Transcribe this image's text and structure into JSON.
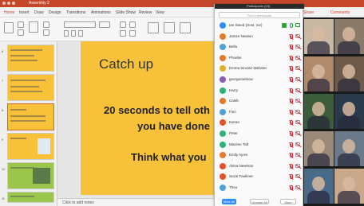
{
  "app": {
    "title": "Assembly 2",
    "brand_color": "#c4472a"
  },
  "ribbon": {
    "tabs": [
      "Home",
      "Insert",
      "Draw",
      "Design",
      "Transitions",
      "Animations",
      "Slide Show",
      "Review",
      "View"
    ],
    "share_label": "Share",
    "comments_label": "Comments"
  },
  "thumbnails": [
    {
      "number": "6"
    },
    {
      "number": "7"
    },
    {
      "number": "8"
    },
    {
      "number": "9"
    },
    {
      "number": "10"
    },
    {
      "number": "11"
    },
    {
      "number": "12"
    }
  ],
  "slide": {
    "title": "Catch up",
    "line1": "20 seconds to tell oth",
    "line2": "you have done",
    "line3": "Think what you",
    "background": "#f7c23a"
  },
  "notes": {
    "placeholder": "Click to add notes"
  },
  "participants_panel": {
    "header": "Participants (23)",
    "search_placeholder": "Find a participant",
    "participants": [
      {
        "name": "Ian Steed (Host, me)",
        "avatar_color": "#2d8cff",
        "mic": "on",
        "cam": "on"
      },
      {
        "name": "James Newton",
        "avatar_color": "#e57a2b",
        "mic": "off",
        "cam": "off"
      },
      {
        "name": "Bella",
        "avatar_color": "#4fa3d9",
        "mic": "off",
        "cam": "off"
      },
      {
        "name": "Phoebe",
        "avatar_color": "#e57a2b",
        "mic": "off",
        "cam": "off"
      },
      {
        "name": "Emma Sinclair-Webster",
        "avatar_color": "#e5b02b",
        "mic": "off",
        "cam": "off"
      },
      {
        "name": "georgerainbow",
        "avatar_color": "#8d5ab7",
        "mic": "off",
        "cam": "off"
      },
      {
        "name": "Harry",
        "avatar_color": "#2fb17a",
        "mic": "off",
        "cam": "off"
      },
      {
        "name": "Caleb",
        "avatar_color": "#e57a2b",
        "mic": "off",
        "cam": "off"
      },
      {
        "name": "Finn",
        "avatar_color": "#4fa3d9",
        "mic": "off",
        "cam": "off"
      },
      {
        "name": "Kieran",
        "avatar_color": "#e5502b",
        "mic": "off",
        "cam": "off"
      },
      {
        "name": "Peter",
        "avatar_color": "#2fb17a",
        "mic": "off",
        "cam": "off"
      },
      {
        "name": "Maxime Taft",
        "avatar_color": "#2fb17a",
        "mic": "off",
        "cam": "off"
      },
      {
        "name": "Emily Ayres",
        "avatar_color": "#e57a2b",
        "mic": "off",
        "cam": "off"
      },
      {
        "name": "Alexa Newman",
        "avatar_color": "#e5502b",
        "mic": "off",
        "cam": "off"
      },
      {
        "name": "Suzie Faulkner",
        "avatar_color": "#e5502b",
        "mic": "off",
        "cam": "off"
      },
      {
        "name": "Theo",
        "avatar_color": "#4fa3d9",
        "mic": "off",
        "cam": "off"
      }
    ],
    "buttons": {
      "mute_all": "Mute All",
      "unmute_all": "Unmute All",
      "more": "More"
    }
  },
  "video_tiles": [
    {
      "tone": "#c9b9a2"
    },
    {
      "tone": "#8a7a6a"
    },
    {
      "tone": "#b08a6a"
    },
    {
      "tone": "#6d5a4a"
    },
    {
      "tone": "#3b5d3a"
    },
    {
      "tone": "#2a3a4a"
    },
    {
      "tone": "#9a8a7a"
    },
    {
      "tone": "#6a7a8a"
    },
    {
      "tone": "#4a6a8a"
    },
    {
      "tone": "#c9a98a"
    }
  ]
}
